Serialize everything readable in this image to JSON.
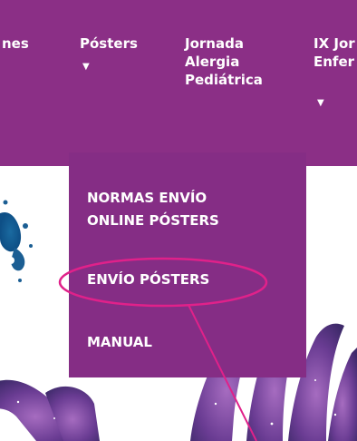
{
  "nav": {
    "items": [
      {
        "label": "nes",
        "has_caret": false
      },
      {
        "label": "Pósters",
        "has_caret": true
      },
      {
        "label": "Jornada\nAlergia\nPediátrica",
        "has_caret": false
      },
      {
        "label": "IX Jor\nEnfer",
        "has_caret": true
      }
    ]
  },
  "dropdown": {
    "items": [
      {
        "label": "NORMAS ENVÍO\nONLINE PÓSTERS"
      },
      {
        "label": "ENVÍO PÓSTERS",
        "highlighted": true
      },
      {
        "label": "MANUAL"
      }
    ]
  },
  "colors": {
    "nav_bg": "#8b2f86",
    "dropdown_bg": "#852d85",
    "text": "#ffffff",
    "annotation": "#e0218a"
  },
  "icons": {
    "caret": "caret-down-icon"
  }
}
